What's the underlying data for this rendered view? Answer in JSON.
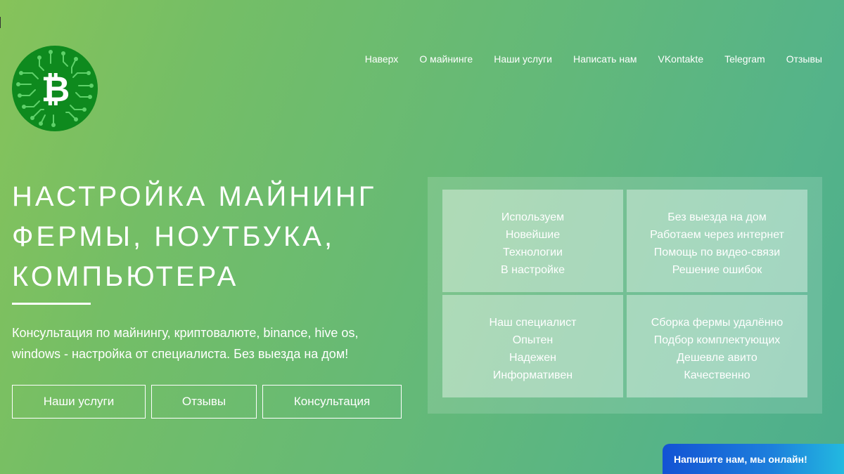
{
  "nav": {
    "items": [
      {
        "label": "Наверх"
      },
      {
        "label": "О майнинге"
      },
      {
        "label": "Наши услуги"
      },
      {
        "label": "Написать нам"
      },
      {
        "label": "VKontakte"
      },
      {
        "label": "Telegram"
      },
      {
        "label": "Отзывы"
      }
    ]
  },
  "logo": {
    "icon": "bitcoin-circuit-logo",
    "glyph": "₿",
    "colors": {
      "circle": "#0e8a1e",
      "circuit": "#5fd16a",
      "glyph": "#ffffff"
    }
  },
  "hero": {
    "title": "НАСТРОЙКА МАЙНИНГ\nФЕРМЫ, НОУТБУКА,\nКОМПЬЮТЕРА",
    "description": "Консультация по майнингу, криптовалюте, binance, hive os, windows - настройка от специалиста. Без выезда на дом!",
    "buttons": {
      "services": "Наши услуги",
      "reviews": "Отзывы",
      "consult": "Консультация"
    }
  },
  "features": [
    {
      "lines": [
        "Используем",
        "Новейшие",
        "Технологии",
        "В настройке"
      ]
    },
    {
      "lines": [
        "Без выезда на дом",
        "Работаем через интернет",
        "Помощь по видео-связи",
        "Решение ошибок"
      ]
    },
    {
      "lines": [
        "Наш специалист",
        "Опытен",
        "Надежен",
        "Информативен"
      ]
    },
    {
      "lines": [
        "Сборка фермы удалённо",
        "Подбор комплектующих",
        "Дешевле авито",
        "Качественно"
      ]
    }
  ],
  "chat": {
    "label": "Напишите нам, мы онлайн!"
  },
  "colors": {
    "background_start": "#86c35a",
    "background_end": "#4dae8c",
    "chat_start": "#1353d4",
    "chat_end": "#23b9e0"
  }
}
